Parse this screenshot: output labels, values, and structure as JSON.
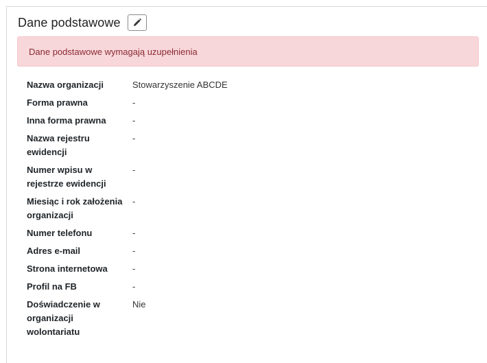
{
  "section": {
    "title": "Dane podstawowe",
    "edit_icon": "pencil-icon"
  },
  "alert": {
    "text": "Dane podstawowe wymagają uzupełnienia",
    "color": "#f8d7da"
  },
  "fields": [
    {
      "label": "Nazwa organizacji",
      "value": "Stowarzyszenie ABCDE"
    },
    {
      "label": "Forma prawna",
      "value": "-"
    },
    {
      "label": "Inna forma prawna",
      "value": "-"
    },
    {
      "label": "Nazwa rejestru ewidencji",
      "value": "-"
    },
    {
      "label": "Numer wpisu w rejestrze ewidencji",
      "value": "-"
    },
    {
      "label": "Miesiąc i rok założenia organizacji",
      "value": "-"
    },
    {
      "label": "Numer telefonu",
      "value": "-"
    },
    {
      "label": "Adres e-mail",
      "value": "-"
    },
    {
      "label": "Strona internetowa",
      "value": "-"
    },
    {
      "label": "Profil na FB",
      "value": "-"
    },
    {
      "label": "Doświadczenie w organizacji wolontariatu",
      "value": "Nie"
    }
  ]
}
